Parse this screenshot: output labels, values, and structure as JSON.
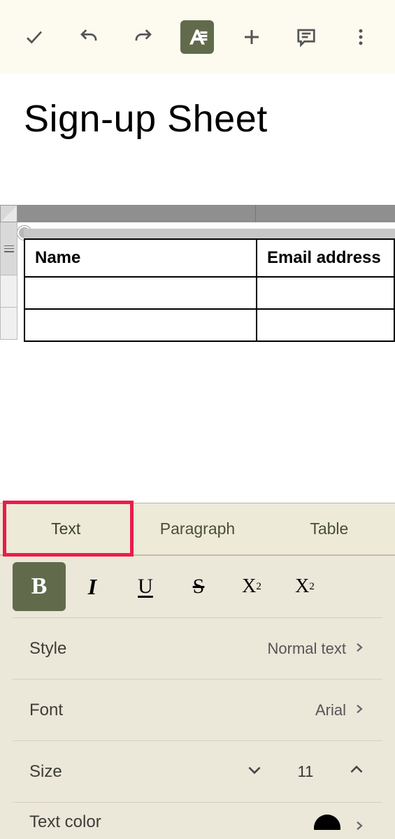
{
  "toolbar": {
    "icons": {
      "check": "check-icon",
      "undo": "undo-icon",
      "redo": "redo-icon",
      "textformat": "text-format-icon",
      "plus": "plus-icon",
      "comment": "comment-icon",
      "more": "more-vertical-icon"
    }
  },
  "document": {
    "title": "Sign-up Sheet",
    "table": {
      "headers": [
        "Name",
        "Email address"
      ],
      "rows": [
        [
          "",
          ""
        ],
        [
          "",
          ""
        ]
      ]
    }
  },
  "panel": {
    "tabs": [
      "Text",
      "Paragraph",
      "Table"
    ],
    "active_tab": 0,
    "format_buttons": {
      "bold": "B",
      "italic": "I",
      "underline": "U",
      "strike": "S",
      "superscript_base": "X",
      "superscript_exp": "2",
      "subscript_base": "X",
      "subscript_sub": "2"
    },
    "style": {
      "label": "Style",
      "value": "Normal text"
    },
    "font": {
      "label": "Font",
      "value": "Arial"
    },
    "size": {
      "label": "Size",
      "value": "11"
    },
    "text_color": {
      "label": "Text color",
      "value": "#000000"
    }
  }
}
